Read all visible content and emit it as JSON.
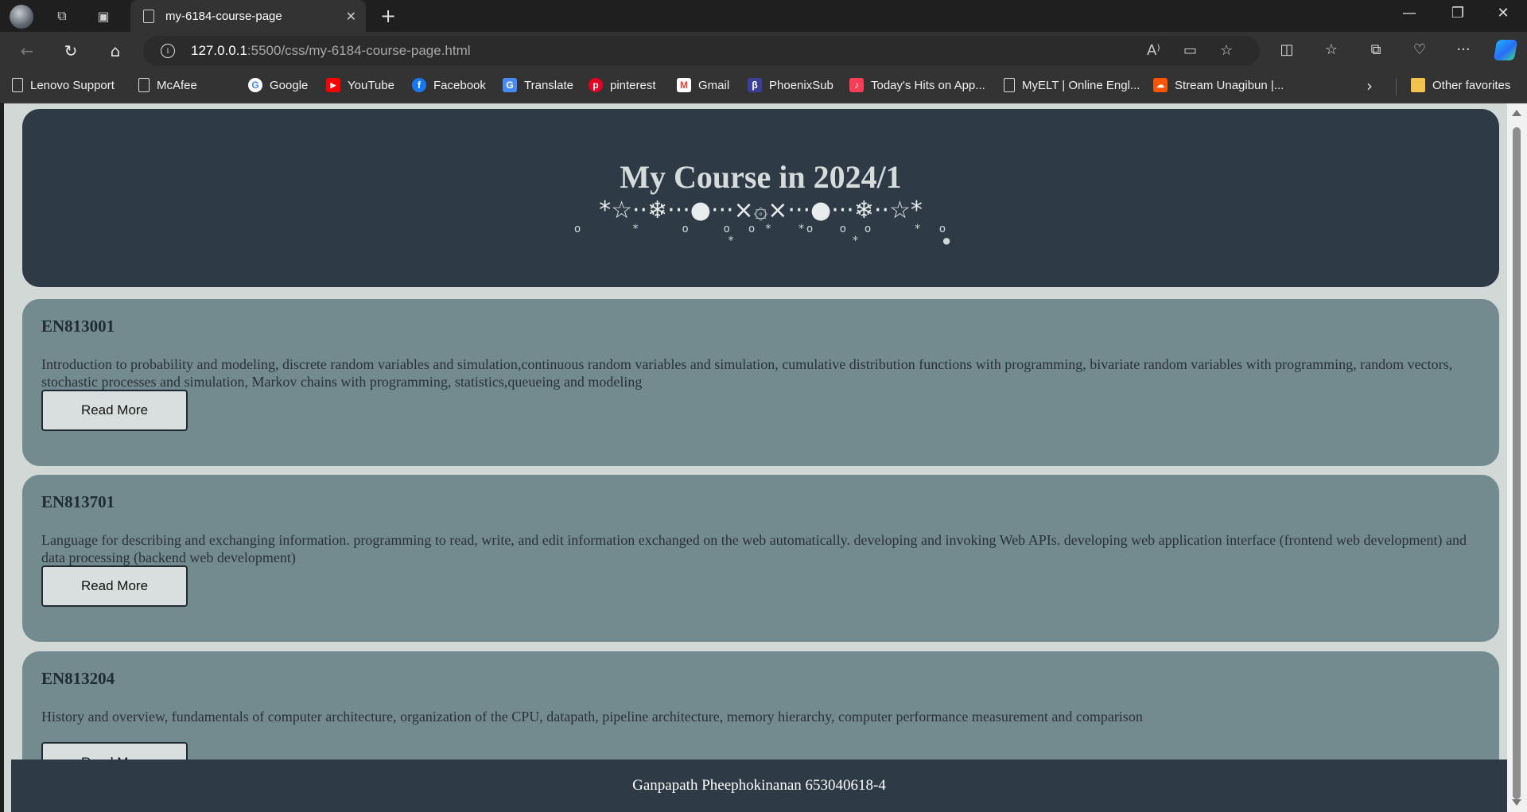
{
  "browser": {
    "tab_title": "my-6184-course-page",
    "url_host": "127.0.0.1",
    "url_rest": ":5500/css/my-6184-course-page.html",
    "bookmarks": [
      {
        "label": "Lenovo Support",
        "icon": "document-icon"
      },
      {
        "label": "McAfee",
        "icon": "document-icon"
      },
      {
        "label": "Google",
        "icon": "google-icon",
        "color": "#4285f4"
      },
      {
        "label": "YouTube",
        "icon": "youtube-icon",
        "color": "#ff0000"
      },
      {
        "label": "Facebook",
        "icon": "facebook-icon",
        "color": "#1877f2"
      },
      {
        "label": "Translate",
        "icon": "translate-icon",
        "color": "#4a8af4"
      },
      {
        "label": "pinterest",
        "icon": "pinterest-icon",
        "color": "#e60023"
      },
      {
        "label": "Gmail",
        "icon": "gmail-icon",
        "color": "#ea4335"
      },
      {
        "label": "PhoenixSub",
        "icon": "phoenixsub-icon",
        "color": "#3b3f99"
      },
      {
        "label": "Today's Hits on App...",
        "icon": "apple-music-icon",
        "color": "#fa3c55"
      },
      {
        "label": "MyELT | Online Engl...",
        "icon": "document-icon"
      },
      {
        "label": "Stream Unagibun |...",
        "icon": "soundcloud-icon",
        "color": "#ff5500"
      }
    ],
    "other_favorites": "Other favorites"
  },
  "page": {
    "hero_title": "My Course in 2024/1",
    "hero_ornament": "*☆··❄···●···×۞×···●···❄··☆*",
    "hero_ornament_sub": "o      *     o    o  o *   *o   o  o     *  o\n                   *              *          ●",
    "courses": [
      {
        "code": "EN813001",
        "description": "Introduction to probability and modeling, discrete random variables and simulation,continuous random variables and simulation, cumulative distribution functions with programming, bivariate random variables with programming, random vectors, stochastic processes and simulation, Markov chains with programming, statistics,queueing and modeling",
        "button": "Read More"
      },
      {
        "code": "EN813701",
        "description": "Language for describing and exchanging information. programming to read, write, and edit information exchanged on the web automatically. developing and invoking Web APIs. developing web application interface (frontend web development) and data processing (backend web development)",
        "button": "Read More"
      },
      {
        "code": "EN813204",
        "description": "History and overview, fundamentals of computer architecture, organization of the CPU, datapath, pipeline architecture, memory hierarchy, computer performance measurement and comparison",
        "button": "Read More"
      }
    ],
    "footer": "Ganpapath Pheephokinanan 653040618-4"
  },
  "colors": {
    "page_bg": "#d1d8d6",
    "dark": "#2e3a45",
    "card": "#738b8f"
  }
}
